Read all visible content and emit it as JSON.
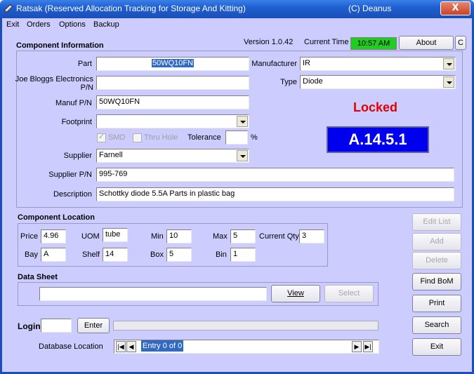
{
  "window": {
    "title": "Ratsak (Reserved Allocation Tracking for Storage And Kitting)",
    "credit": "(C) Deanus",
    "close_label": "X"
  },
  "menu": [
    "Exit",
    "Orders",
    "Options",
    "Backup"
  ],
  "header": {
    "version": "Version 1.0.42",
    "time_label": "Current Time",
    "time_value": "10:57 AM",
    "about_label": "About",
    "c_label": "C"
  },
  "component_info": {
    "section_title": "Component Information",
    "part_label": "Part",
    "part_value": "50WQ10FN",
    "jb_label_line1": "Joe Bloggs Electronics",
    "jb_label_line2": "P/N",
    "jb_value": "",
    "manuf_pn_label": "Manuf P/N",
    "manuf_pn_value": "50WQ10FN",
    "footprint_label": "Footprint",
    "footprint_value": "",
    "smd_label": "SMD",
    "thru_hole_label": "Thru Hole",
    "tolerance_label": "Tolerance",
    "tolerance_value": "",
    "percent_label": "%",
    "supplier_label": "Supplier",
    "supplier_value": "Farnell",
    "supplier_pn_label": "Supplier P/N",
    "supplier_pn_value": "995-769",
    "description_label": "Description",
    "description_value": "Schottky diode 5.5A  Parts in plastic bag",
    "manufacturer_label": "Manufacturer",
    "manufacturer_value": "IR",
    "type_label": "Type",
    "type_value": "Diode",
    "status": "Locked",
    "location_code": "A.14.5.1"
  },
  "component_location": {
    "section_title": "Component Location",
    "price_label": "Price",
    "price_value": "4.96",
    "uom_label": "UOM",
    "uom_value": "tube",
    "min_label": "Min",
    "min_value": "10",
    "max_label": "Max",
    "max_value": "5",
    "current_qty_label": "Current Qty",
    "current_qty_value": "3",
    "bay_label": "Bay",
    "bay_value": "A",
    "shelf_label": "Shelf",
    "shelf_value": "14",
    "box_label": "Box",
    "box_value": "5",
    "bin_label": "Bin",
    "bin_value": "1"
  },
  "data_sheet": {
    "section_title": "Data Sheet",
    "path_value": "",
    "view_label": "View",
    "select_label": "Select"
  },
  "login": {
    "label": "Login",
    "value": "",
    "enter_label": "Enter"
  },
  "database": {
    "label": "Database Location",
    "entry_text": "Entry 0 of 0"
  },
  "side_buttons": {
    "edit_list": "Edit List",
    "add": "Add",
    "delete": "Delete",
    "find_bom": "Find BoM",
    "print": "Print",
    "search": "Search",
    "exit": "Exit"
  },
  "colors": {
    "background": "#ccccff",
    "time_box": "#22cc22",
    "locked": "#e00000",
    "location_box": "#0000ee"
  }
}
